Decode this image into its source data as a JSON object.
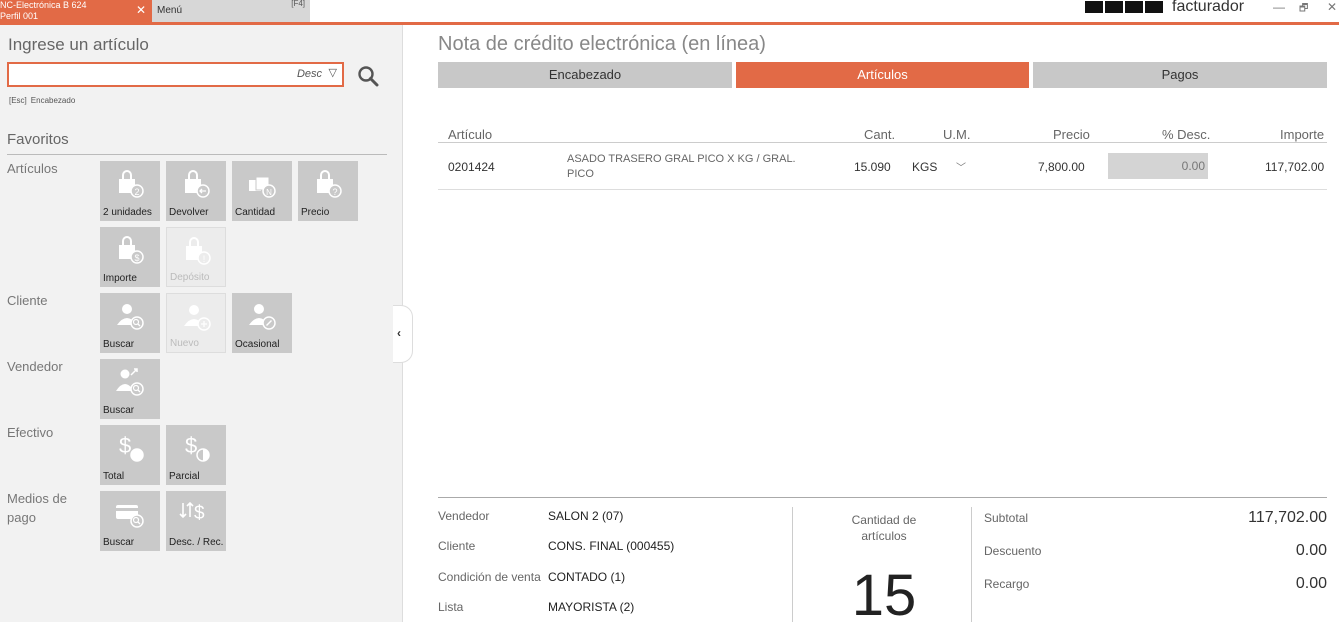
{
  "tabs": {
    "active_line1": "NC-Electrónica B 624",
    "active_line2": "Perfil 001",
    "close": "✕",
    "menu_label": "Menú",
    "menu_key": "[F4]"
  },
  "app": {
    "name": "facturador",
    "minimize": "—",
    "restore": "🗗",
    "close": "✕"
  },
  "left": {
    "heading": "Ingrese un artículo",
    "search_value": "",
    "search_mode": "Desc",
    "search_chevron": "▽",
    "hint_key": "[Esc]",
    "hint_label": "Encabezado",
    "favorites_title": "Favoritos",
    "sections": {
      "articulos": "Artículos",
      "cliente": "Cliente",
      "vendedor": "Vendedor",
      "efectivo": "Efectivo",
      "medios_de_pago": "Medios de pago"
    },
    "tiles": {
      "dos_unidades": "2 unidades",
      "devolver": "Devolver",
      "cantidad": "Cantidad",
      "precio": "Precio",
      "importe": "Importe",
      "deposito": "Depósito",
      "cliente_buscar": "Buscar",
      "cliente_nuevo": "Nuevo",
      "cliente_ocasional": "Ocasional",
      "vendedor_buscar": "Buscar",
      "efectivo_total": "Total",
      "efectivo_parcial": "Parcial",
      "pago_buscar": "Buscar",
      "pago_desc_rec": "Desc. / Rec."
    },
    "collapse": "‹"
  },
  "main": {
    "title": "Nota de crédito electrónica (en línea)",
    "tabs": [
      "Encabezado",
      "Artículos",
      "Pagos"
    ],
    "columns": {
      "articulo": "Artículo",
      "cant": "Cant.",
      "um": "U.M.",
      "precio": "Precio",
      "desc": "% Desc.",
      "importe": "Importe"
    },
    "rows": [
      {
        "codigo": "0201424",
        "descripcion": "ASADO TRASERO GRAL PICO X KG  / GRAL. PICO",
        "cantidad": "15.090",
        "um": "KGS",
        "um_chevron": "﹀",
        "precio": "7,800.00",
        "descuento": "0.00",
        "importe": "117,702.00"
      }
    ],
    "footer": {
      "vendedor_label": "Vendedor",
      "vendedor_value": "SALON 2 (07)",
      "cliente_label": "Cliente",
      "cliente_value": "CONS. FINAL (000455)",
      "condicion_label": "Condición de venta",
      "condicion_value": "CONTADO  (1)",
      "lista_label": "Lista",
      "lista_value": "MAYORISTA (2)",
      "cantidad_label": "Cantidad de artículos",
      "cantidad_value": "15",
      "subtotal_label": "Subtotal",
      "subtotal_value": "117,702.00",
      "descuento_label": "Descuento",
      "descuento_value": "0.00",
      "recargo_label": "Recargo",
      "recargo_value": "0.00"
    }
  },
  "colors": {
    "accent": "#e26a46",
    "tile": "#c9c9c9",
    "panel": "#f2f2f2"
  }
}
